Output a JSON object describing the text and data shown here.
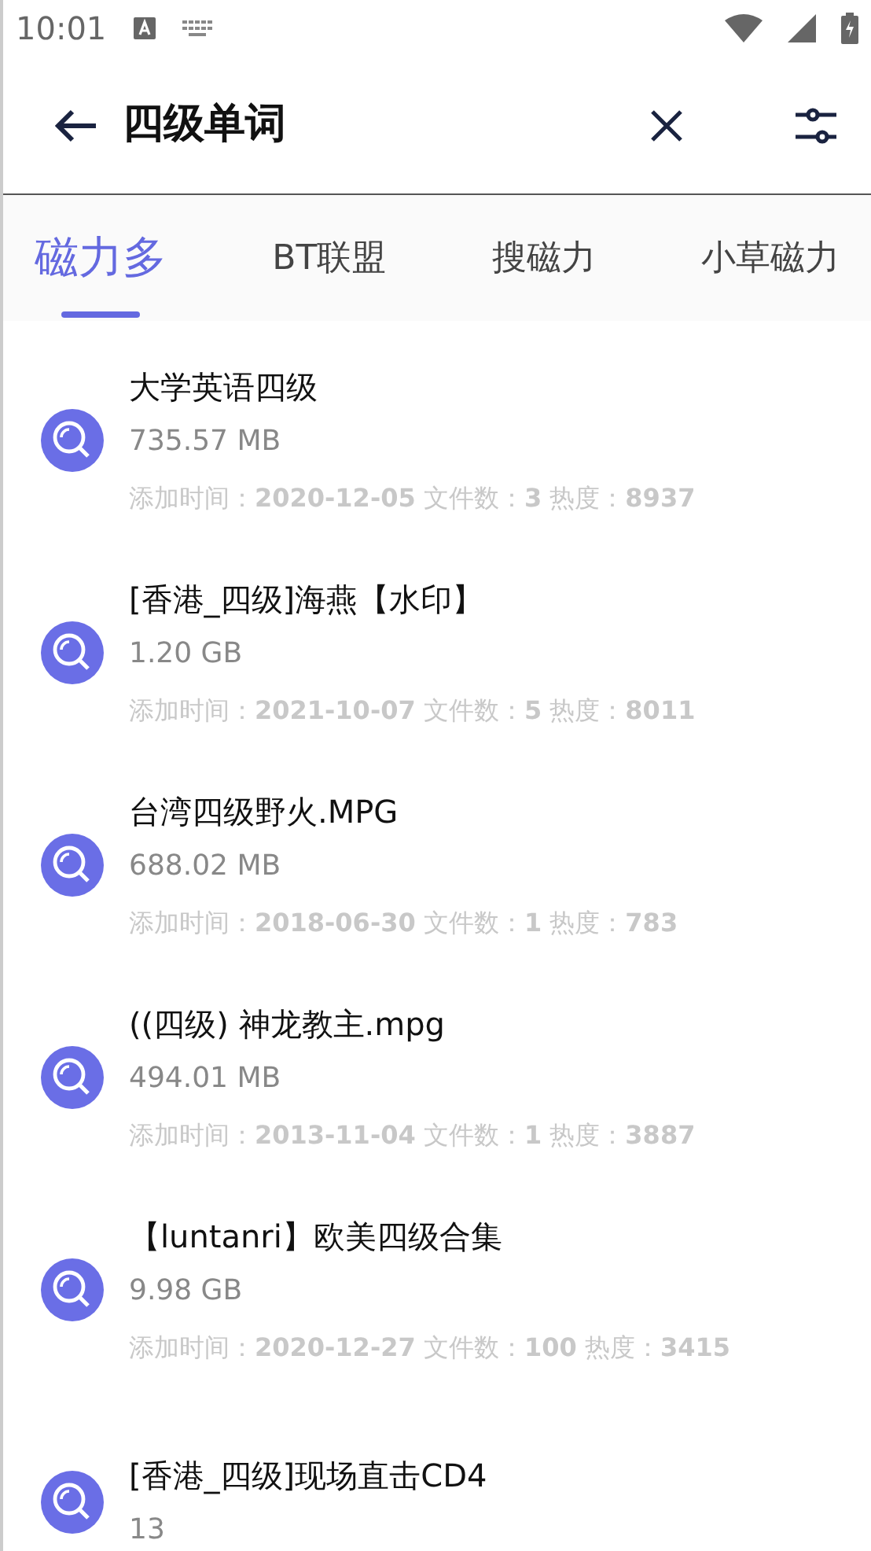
{
  "status_bar": {
    "time": "10:01"
  },
  "search": {
    "value": "四级单词"
  },
  "tabs": [
    {
      "label": "磁力多",
      "selected": true
    },
    {
      "label": "BT联盟",
      "selected": false
    },
    {
      "label": "搜磁力",
      "selected": false
    },
    {
      "label": "小草磁力",
      "selected": false
    }
  ],
  "results": [
    {
      "title": "大学英语四级",
      "size": "735.57 MB",
      "meta": [
        {
          "label": "添加时间：",
          "value": "2020-12-05"
        },
        {
          "label": "文件数：",
          "value": "3"
        },
        {
          "label": "热度：",
          "value": "8937"
        }
      ]
    },
    {
      "title": "[香港_四级]海燕【水印】",
      "size": "1.20 GB",
      "meta": [
        {
          "label": "添加时间：",
          "value": "2021-10-07"
        },
        {
          "label": "文件数：",
          "value": "5"
        },
        {
          "label": "热度：",
          "value": "8011"
        }
      ]
    },
    {
      "title": "台湾四级野火.MPG",
      "size": "688.02 MB",
      "meta": [
        {
          "label": "添加时间：",
          "value": "2018-06-30"
        },
        {
          "label": "文件数：",
          "value": "1"
        },
        {
          "label": "热度：",
          "value": "783"
        }
      ]
    },
    {
      "title": "((四级) 神龙教主.mpg",
      "size": "494.01 MB",
      "meta": [
        {
          "label": "添加时间：",
          "value": "2013-11-04"
        },
        {
          "label": "文件数：",
          "value": "1"
        },
        {
          "label": "热度：",
          "value": "3887"
        }
      ]
    },
    {
      "title": "【luntanri】欧美四级合集",
      "size": "9.98 GB",
      "meta": [
        {
          "label": "添加时间：",
          "value": "2020-12-27"
        },
        {
          "label": "文件数：",
          "value": "100"
        },
        {
          "label": "热度：",
          "value": "3415"
        }
      ]
    },
    {
      "title": "[香港_四级]现场直击CD4",
      "size": "13"
    }
  ]
}
